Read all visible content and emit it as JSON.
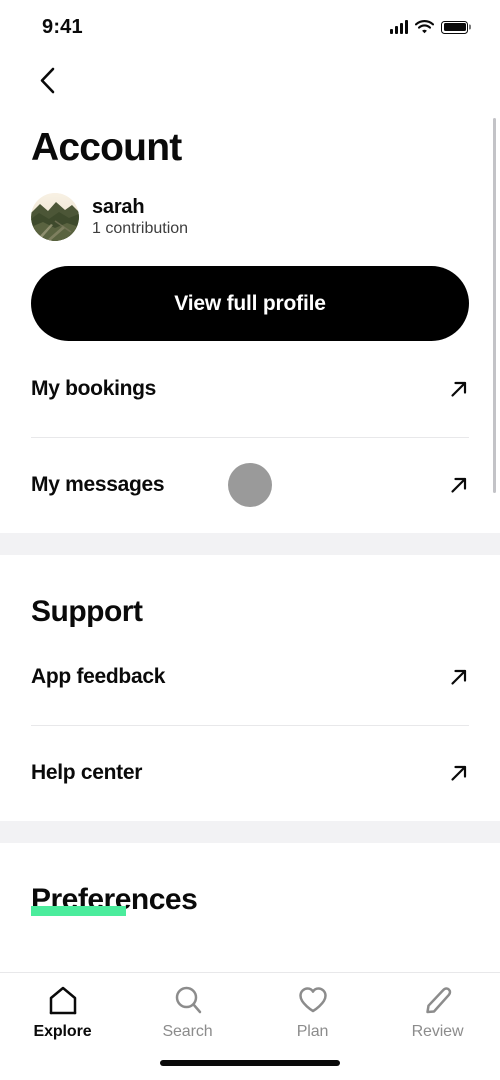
{
  "status_bar": {
    "time": "9:41",
    "cellular_icon": "cellular-bars-icon",
    "wifi_icon": "wifi-icon",
    "battery_icon": "battery-full-icon"
  },
  "nav": {
    "back_icon": "chevron-left-icon"
  },
  "header": {
    "title": "Account"
  },
  "profile": {
    "avatar_icon": "user-avatar-landscape-image",
    "name": "sarah",
    "contributions": "1 contribution",
    "cta_label": "View full profile"
  },
  "account_section": {
    "rows": [
      {
        "label": "My bookings",
        "icon": "external-link-arrow-icon",
        "has_dot": false
      },
      {
        "label": "My messages",
        "icon": "external-link-arrow-icon",
        "has_dot": true
      }
    ]
  },
  "support_section": {
    "title": "Support",
    "rows": [
      {
        "label": "App feedback",
        "icon": "external-link-arrow-icon"
      },
      {
        "label": "Help center",
        "icon": "external-link-arrow-icon"
      }
    ]
  },
  "preferences_section": {
    "title": "Preferences"
  },
  "tab_bar": {
    "tabs": [
      {
        "label": "Explore",
        "icon": "home-icon",
        "active": true
      },
      {
        "label": "Search",
        "icon": "search-icon",
        "active": false
      },
      {
        "label": "Plan",
        "icon": "heart-icon",
        "active": false
      },
      {
        "label": "Review",
        "icon": "pencil-icon",
        "active": false
      }
    ]
  },
  "colors": {
    "accent_green": "#4bec9c",
    "primary_black": "#000000",
    "section_divider": "#f2f2f4",
    "muted_grey": "#8c8c8c",
    "placeholder_dot": "#9a9a9a"
  }
}
